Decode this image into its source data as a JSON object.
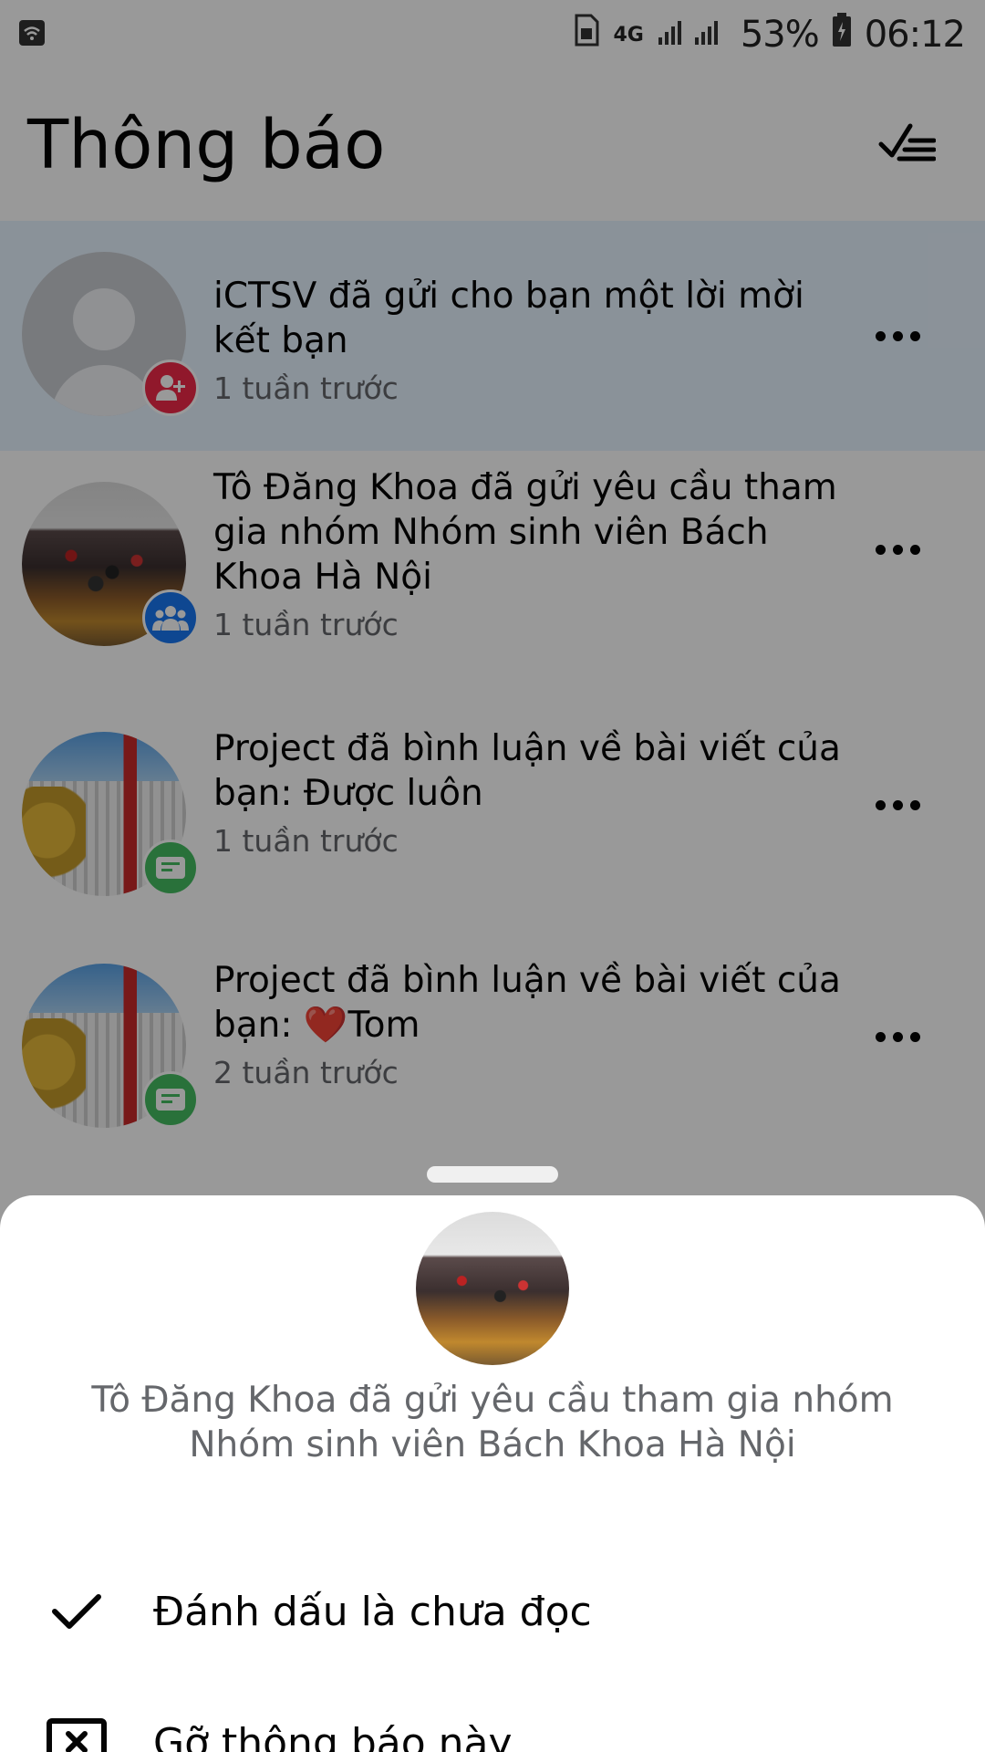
{
  "status_bar": {
    "network": "4G",
    "battery": "53%",
    "time": "06:12"
  },
  "header": {
    "title": "Thông báo"
  },
  "notifications": [
    {
      "text": "iCTSV đã gửi cho bạn một lời mời kết bạn",
      "time": "1 tuần trước",
      "avatar": "default-user",
      "badge_icon": "add-friend-icon",
      "badge_color": "#f02849",
      "unread": true
    },
    {
      "text": "Tô Đăng Khoa đã gửi yêu cầu tham gia nhóm Nhóm sinh viên Bách Khoa Hà Nội",
      "time": "1 tuần trước",
      "avatar": "group-photo",
      "badge_icon": "group-icon",
      "badge_color": "#1877f2",
      "unread": false
    },
    {
      "text": "Project đã bình luận về bài viết của bạn: Được luôn",
      "time": "1 tuần trước",
      "avatar": "building-photo",
      "badge_icon": "comment-icon",
      "badge_color": "#45bd62",
      "unread": false
    },
    {
      "text": "Project đã bình luận về bài viết của bạn: ❤️Tom",
      "time": "2 tuần trước",
      "avatar": "building-photo",
      "badge_icon": "comment-icon",
      "badge_color": "#45bd62",
      "unread": false
    }
  ],
  "sheet": {
    "description": "Tô Đăng Khoa đã gửi yêu cầu tham gia nhóm Nhóm sinh viên Bách Khoa Hà Nội",
    "actions": [
      {
        "label": "Đánh dấu là chưa đọc",
        "icon": "check-icon"
      },
      {
        "label": "Gỡ thông báo này",
        "icon": "remove-box-icon"
      }
    ]
  }
}
